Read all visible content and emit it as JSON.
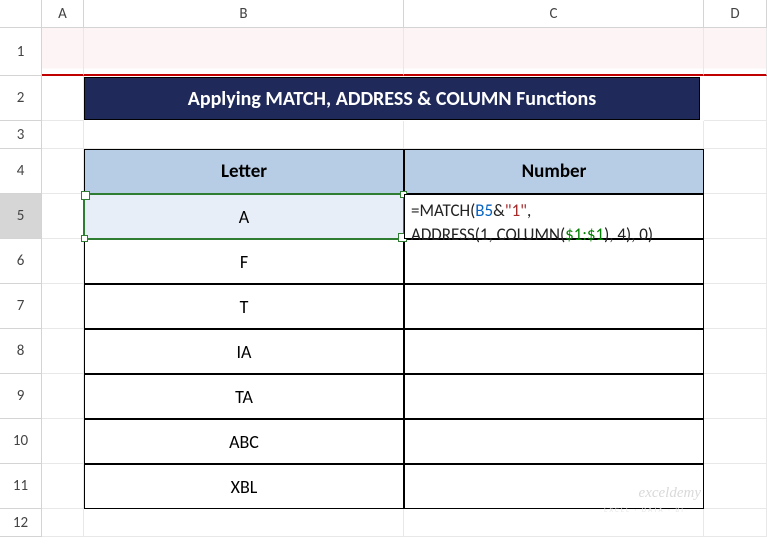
{
  "columns": {
    "A": "A",
    "B": "B",
    "C": "C",
    "D": "D"
  },
  "rows": [
    "1",
    "2",
    "3",
    "4",
    "5",
    "6",
    "7",
    "8",
    "9",
    "10",
    "11",
    "12"
  ],
  "title": "Applying MATCH, ADDRESS & COLUMN Functions",
  "headers": {
    "letter": "Letter",
    "number": "Number"
  },
  "letters": [
    "A",
    "F",
    "T",
    "IA",
    "TA",
    "ABC",
    "XBL"
  ],
  "formula": {
    "p1": "=MATCH(",
    "ref1": "B5",
    "p2": "&",
    "str1": "\"1\"",
    "p3": ", ",
    "p4": "ADDRESS(1, COLUMN(",
    "ref2": "$1:$1",
    "p5": "), 4), 0)"
  },
  "watermark": "exceldemy",
  "watermark_sub": "EXCEL · DATA · BI"
}
